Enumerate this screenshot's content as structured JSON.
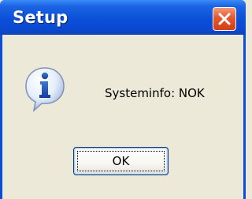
{
  "window": {
    "title": "Setup"
  },
  "dialog": {
    "message": "Systeminfo: NOK",
    "icon": "information-icon",
    "ok_label": "OK"
  },
  "colors": {
    "titlebar": "#0b50d8",
    "close_button": "#e2582c",
    "dialog_background": "#ece9d8",
    "button_border": "#003c74"
  }
}
